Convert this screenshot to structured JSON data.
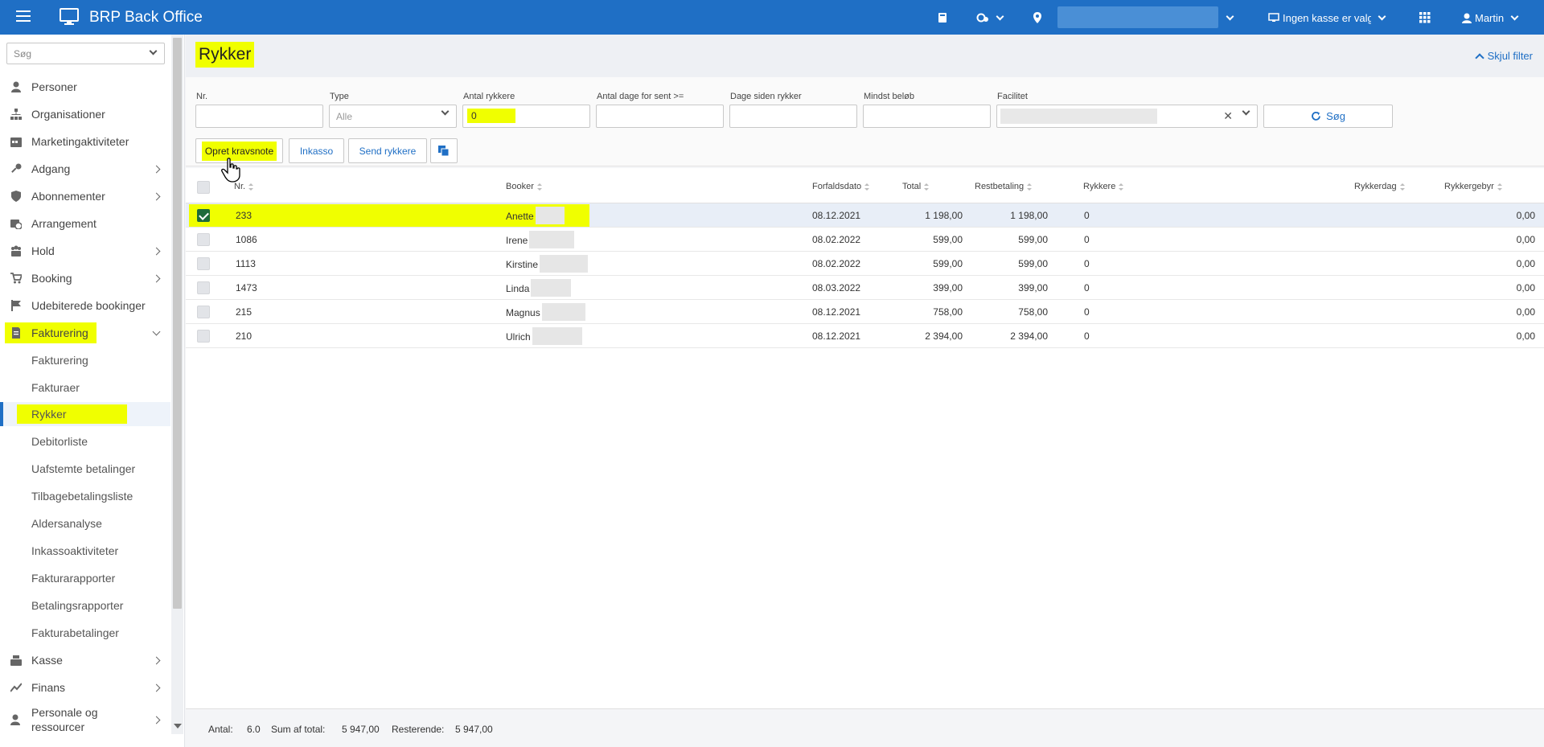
{
  "app": {
    "title": "BRP Back Office"
  },
  "topbar": {
    "cash_register": "Ingen kasse er valgt",
    "user": "Martin"
  },
  "sidebar": {
    "search_placeholder": "Søg",
    "items": [
      {
        "label": "Personer",
        "icon": "person-icon"
      },
      {
        "label": "Organisationer",
        "icon": "org-chart-icon"
      },
      {
        "label": "Marketingaktiviteter",
        "icon": "calendar-icon"
      },
      {
        "label": "Adgang",
        "icon": "key-icon"
      },
      {
        "label": "Abonnementer",
        "icon": "shield-icon"
      },
      {
        "label": "Arrangement",
        "icon": "calendar-clock-icon"
      },
      {
        "label": "Hold",
        "icon": "group-icon"
      },
      {
        "label": "Booking",
        "icon": "cart-icon"
      },
      {
        "label": "Udebiterede bookinger",
        "icon": "flag-icon"
      },
      {
        "label": "Fakturering",
        "icon": "invoice-icon"
      },
      {
        "label": "Kasse",
        "icon": "cash-register-icon"
      },
      {
        "label": "Finans",
        "icon": "trend-icon"
      },
      {
        "label": "Personale og ressourcer",
        "icon": "staff-icon"
      }
    ],
    "sub_items": [
      "Fakturering",
      "Fakturaer",
      "Rykker",
      "Debitorliste",
      "Uafstemte betalinger",
      "Tilbagebetalingsliste",
      "Aldersanalyse",
      "Inkassoaktiviteter",
      "Fakturarapporter",
      "Betalingsrapporter",
      "Fakturabetalinger"
    ]
  },
  "page": {
    "title": "Rykker",
    "hide_filter": "Skjul filter"
  },
  "filters": {
    "nr_label": "Nr.",
    "type_label": "Type",
    "type_value": "Alle",
    "antal_label": "Antal rykkere",
    "antal_value": "0",
    "dage_sent_label": "Antal dage for sent >=",
    "dage_siden_label": "Dage siden rykker",
    "mindst_label": "Mindst beløb",
    "facilitet_label": "Facilitet",
    "search_button": "Søg"
  },
  "actions": {
    "opret": "Opret kravsnote",
    "inkasso": "Inkasso",
    "send": "Send rykkere"
  },
  "table": {
    "headers": {
      "nr": "Nr.",
      "booker": "Booker",
      "forfald": "Forfaldsdato",
      "total": "Total",
      "rest": "Restbetaling",
      "rykkere": "Rykkere",
      "rykkerdag": "Rykkerdag",
      "gebyr": "Rykkergebyr"
    },
    "rows": [
      {
        "nr": "233",
        "booker": "Anette",
        "forfald": "08.12.2021",
        "total": "1 198,00",
        "rest": "1 198,00",
        "rykkere": "0",
        "gebyr": "0,00",
        "selected": true
      },
      {
        "nr": "1086",
        "booker": "Irene",
        "forfald": "08.02.2022",
        "total": "599,00",
        "rest": "599,00",
        "rykkere": "0",
        "gebyr": "0,00",
        "selected": false
      },
      {
        "nr": "1113",
        "booker": "Kirstine",
        "forfald": "08.02.2022",
        "total": "599,00",
        "rest": "599,00",
        "rykkere": "0",
        "gebyr": "0,00",
        "selected": false
      },
      {
        "nr": "1473",
        "booker": "Linda",
        "forfald": "08.03.2022",
        "total": "399,00",
        "rest": "399,00",
        "rykkere": "0",
        "gebyr": "0,00",
        "selected": false
      },
      {
        "nr": "215",
        "booker": "Magnus",
        "forfald": "08.12.2021",
        "total": "758,00",
        "rest": "758,00",
        "rykkere": "0",
        "gebyr": "0,00",
        "selected": false
      },
      {
        "nr": "210",
        "booker": "Ulrich",
        "forfald": "08.12.2021",
        "total": "2 394,00",
        "rest": "2 394,00",
        "rykkere": "0",
        "gebyr": "0,00",
        "selected": false
      }
    ]
  },
  "footer": {
    "antal_label": "Antal:",
    "antal_value": "6.0",
    "sum_label": "Sum af total:",
    "sum_value": "5 947,00",
    "rest_label": "Resterende:",
    "rest_value": "5 947,00"
  }
}
